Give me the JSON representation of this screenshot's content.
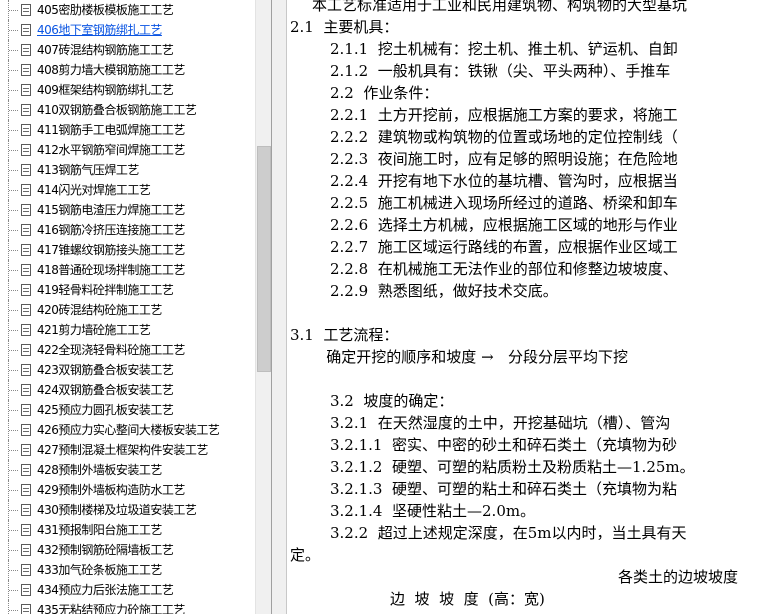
{
  "tree": {
    "items": [
      {
        "label": "405密肋楼板模板施工工艺",
        "selected": false
      },
      {
        "label": "406地下室钢筋绑扎工艺",
        "selected": true
      },
      {
        "label": "407砖混结构钢筋施工工艺",
        "selected": false
      },
      {
        "label": "408剪力墙大模钢筋施工工艺",
        "selected": false
      },
      {
        "label": "409框架结构钢筋绑扎工艺",
        "selected": false
      },
      {
        "label": "410双钢筋叠合板钢筋施工工艺",
        "selected": false
      },
      {
        "label": "411钢筋手工电弧焊施工工艺",
        "selected": false
      },
      {
        "label": "412水平钢筋窄间焊施工工艺",
        "selected": false
      },
      {
        "label": "413钢筋气压焊工艺",
        "selected": false
      },
      {
        "label": "414闪光对焊施工工艺",
        "selected": false
      },
      {
        "label": "415钢筋电渣压力焊施工工艺",
        "selected": false
      },
      {
        "label": "416钢筋冷挤压连接施工工艺",
        "selected": false
      },
      {
        "label": "417锥螺纹钢筋接头施工工艺",
        "selected": false
      },
      {
        "label": "418普通砼现场拌制施工工艺",
        "selected": false
      },
      {
        "label": "419轻骨料砼拌制施工工艺",
        "selected": false
      },
      {
        "label": "420砖混结构砼施工工艺",
        "selected": false
      },
      {
        "label": "421剪力墙砼施工工艺",
        "selected": false
      },
      {
        "label": "422全现浇轻骨料砼施工工艺",
        "selected": false
      },
      {
        "label": "423双钢筋叠合板安装工艺",
        "selected": false
      },
      {
        "label": "424双钢筋叠合板安装工艺",
        "selected": false
      },
      {
        "label": "425预应力圆孔板安装工艺",
        "selected": false
      },
      {
        "label": "426预应力实心整间大楼板安装工艺",
        "selected": false
      },
      {
        "label": "427预制混凝土框架构件安装工艺",
        "selected": false
      },
      {
        "label": "428预制外墙板安装工艺",
        "selected": false
      },
      {
        "label": "429预制外墙板构造防水工艺",
        "selected": false
      },
      {
        "label": "430预制楼梯及垃圾道安装工艺",
        "selected": false
      },
      {
        "label": "431预报制阳台施工工艺",
        "selected": false
      },
      {
        "label": "432预制钢筋砼隔墙板工艺",
        "selected": false
      },
      {
        "label": "433加气砼条板施工工艺",
        "selected": false
      },
      {
        "label": "434预应力后张法施工工艺",
        "selected": false
      },
      {
        "label": "435无粘结预应力砼施工工艺",
        "selected": false
      }
    ]
  },
  "content": {
    "lines": [
      {
        "indent": 2,
        "text": "本工艺标准适用于工业和民用建筑物、构筑物的大型基坑"
      },
      {
        "indent": 0,
        "text": "2.1  主要机具："
      },
      {
        "indent": 1,
        "text": "2.1.1  挖土机械有：挖土机、推土机、铲运机、自卸"
      },
      {
        "indent": 1,
        "text": "2.1.2  一般机具有：铁锹（尖、平头两种）、手推车"
      },
      {
        "indent": 1,
        "text": "2.2  作业条件："
      },
      {
        "indent": 1,
        "text": "2.2.1  土方开挖前，应根据施工方案的要求，将施工"
      },
      {
        "indent": 1,
        "text": "2.2.2  建筑物或构筑物的位置或场地的定位控制线（"
      },
      {
        "indent": 1,
        "text": "2.2.3  夜间施工时，应有足够的照明设施；在危险地"
      },
      {
        "indent": 1,
        "text": "2.2.4  开挖有地下水位的基坑槽、管沟时，应根据当"
      },
      {
        "indent": 1,
        "text": "2.2.5  施工机械进入现场所经过的道路、桥梁和卸车"
      },
      {
        "indent": 1,
        "text": "2.2.6  选择土方机械，应根据施工区域的地形与作业"
      },
      {
        "indent": 1,
        "text": "2.2.7  施工区域运行路线的布置，应根据作业区域工"
      },
      {
        "indent": 1,
        "text": "2.2.8  在机械施工无法作业的部位和修整边坡坡度、"
      },
      {
        "indent": 1,
        "text": "2.2.9  熟悉图纸，做好技术交底。"
      },
      {
        "indent": 0,
        "text": ""
      },
      {
        "indent": 0,
        "text": "3.1  工艺流程："
      },
      {
        "indent": 2,
        "text": "   确定开挖的顺序和坡度 →   分段分层平均下挖"
      },
      {
        "indent": 0,
        "text": ""
      },
      {
        "indent": 1,
        "text": "3.2  坡度的确定："
      },
      {
        "indent": 1,
        "text": "3.2.1  在天然湿度的土中，开挖基础坑（槽）、管沟"
      },
      {
        "indent": 1,
        "text": "3.2.1.1  密实、中密的砂土和碎石类土（充填物为砂"
      },
      {
        "indent": 1,
        "text": "3.2.1.2  硬塑、可塑的粘质粉土及粉质粘土—1.25m。"
      },
      {
        "indent": 1,
        "text": "3.2.1.3  硬塑、可塑的粘土和碎石类土（充填物为粘"
      },
      {
        "indent": 1,
        "text": "3.2.1.4  坚硬性粘土—2.0m。"
      },
      {
        "indent": 1,
        "text": "3.2.2  超过上述规定深度，在5m以内时，当土具有天"
      },
      {
        "indent": 0,
        "text": "定。"
      },
      {
        "indent": 3,
        "text": "各类土的边坡坡度"
      },
      {
        "indent": 4,
        "text": "边  坡  坡  度  (高：宽)"
      }
    ]
  }
}
